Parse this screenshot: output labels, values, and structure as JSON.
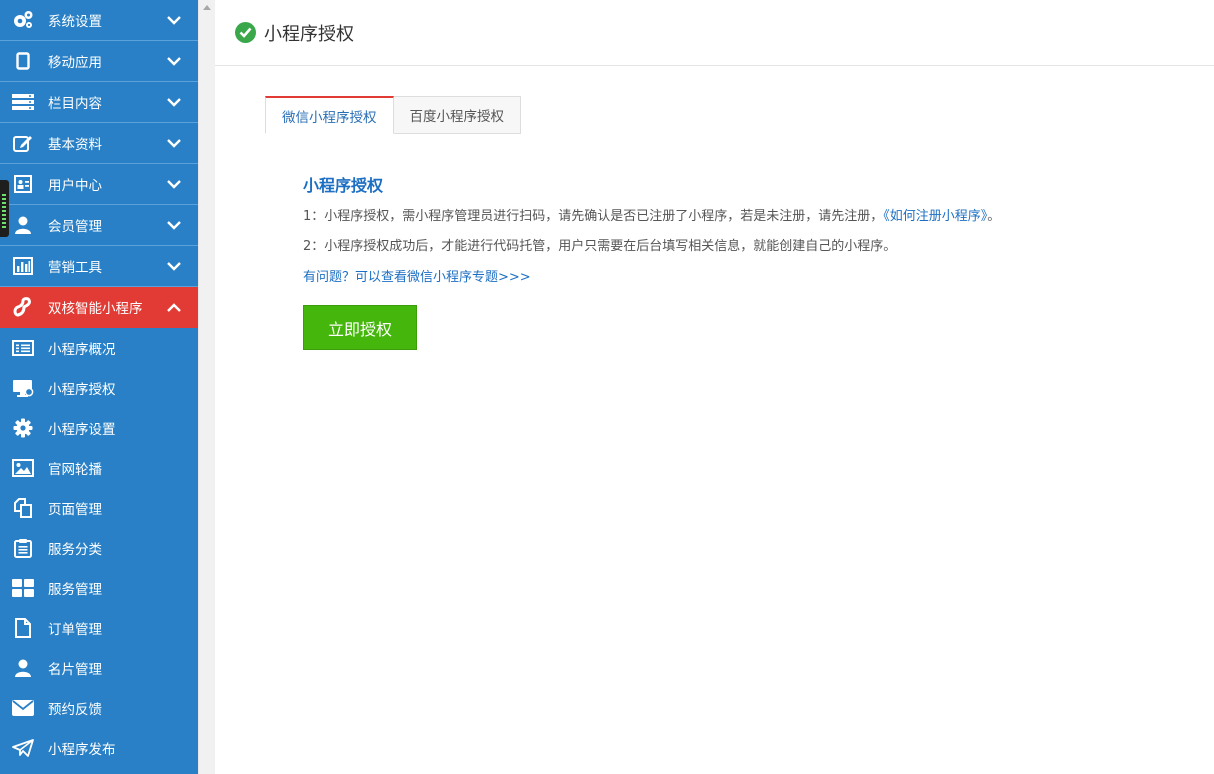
{
  "sidebar": {
    "menus": [
      {
        "label": "系统设置",
        "icon": "gears-icon"
      },
      {
        "label": "移动应用",
        "icon": "tablet-icon"
      },
      {
        "label": "栏目内容",
        "icon": "server-icon"
      },
      {
        "label": "基本资料",
        "icon": "edit-icon"
      },
      {
        "label": "用户中心",
        "icon": "id-card-icon"
      },
      {
        "label": "会员管理",
        "icon": "user-icon"
      },
      {
        "label": "营销工具",
        "icon": "bar-chart-icon"
      }
    ],
    "active_menu": {
      "label": "双核智能小程序",
      "icon": "miniprogram-icon"
    },
    "subitems": [
      {
        "label": "小程序概况",
        "icon": "list-icon"
      },
      {
        "label": "小程序授权",
        "icon": "monitor-icon"
      },
      {
        "label": "小程序设置",
        "icon": "gear-icon"
      },
      {
        "label": "官网轮播",
        "icon": "image-icon"
      },
      {
        "label": "页面管理",
        "icon": "copy-icon"
      },
      {
        "label": "服务分类",
        "icon": "clipboard-icon"
      },
      {
        "label": "服务管理",
        "icon": "grid-icon"
      },
      {
        "label": "订单管理",
        "icon": "file-icon"
      },
      {
        "label": "名片管理",
        "icon": "user-icon"
      },
      {
        "label": "预约反馈",
        "icon": "envelope-icon"
      },
      {
        "label": "小程序发布",
        "icon": "send-icon"
      }
    ]
  },
  "header": {
    "title": "小程序授权"
  },
  "tabs": [
    {
      "label": "微信小程序授权",
      "active": true
    },
    {
      "label": "百度小程序授权",
      "active": false
    }
  ],
  "content": {
    "heading": "小程序授权",
    "line1": "1：小程序授权，需小程序管理员进行扫码，请先确认是否已注册了小程序，若是未注册，请先注册，",
    "line1_link": "《如何注册小程序》",
    "line1_end": "。",
    "line2": "2：小程序授权成功后，才能进行代码托管，用户只需要在后台填写相关信息，就能创建自己的小程序。",
    "help_link": "有问题？可以查看微信小程序专题>>>",
    "button": "立即授权"
  },
  "colors": {
    "sidebar": "#2a80c6",
    "active_menu": "#e23b35",
    "link": "#1d6fc3",
    "button": "#45b60b"
  }
}
